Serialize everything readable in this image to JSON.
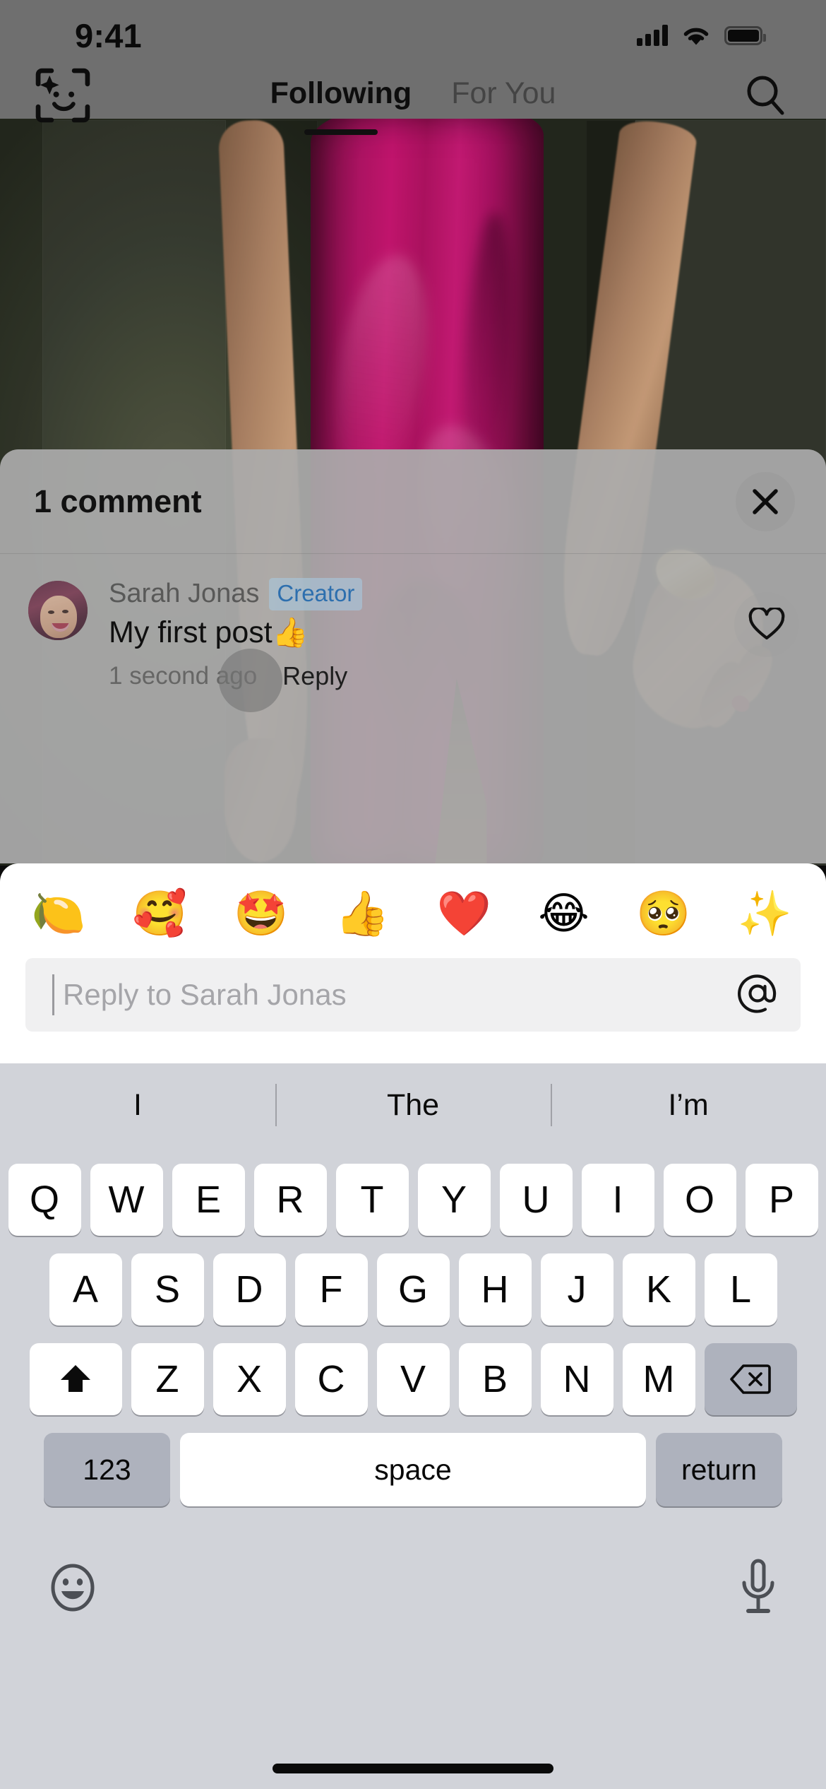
{
  "status_bar": {
    "time": "9:41",
    "signal_icon": "cellular-bars-icon",
    "wifi_icon": "wifi-icon",
    "battery_icon": "battery-full-icon"
  },
  "nav": {
    "live_icon": "live-face-scan-icon",
    "search_icon": "search-icon",
    "tabs": [
      {
        "label": "Following",
        "active": true
      },
      {
        "label": "For You",
        "active": false
      }
    ]
  },
  "comment_sheet": {
    "title": "1 comment",
    "close_icon": "close-icon",
    "comments": [
      {
        "avatar": "user-avatar",
        "name": "Sarah Jonas",
        "badge": "Creator",
        "text": "My first post",
        "text_emoji": "👍",
        "time": "1 second ago",
        "reply_label": "Reply",
        "like_icon": "heart-outline-icon"
      }
    ]
  },
  "reply_panel": {
    "emoji_row": [
      {
        "name": "lemon-emoji",
        "glyph": "🍋"
      },
      {
        "name": "smiling-face-with-hearts-emoji",
        "glyph": "🥰"
      },
      {
        "name": "star-struck-emoji",
        "glyph": "🤩"
      },
      {
        "name": "thumbs-up-emoji",
        "glyph": "👍"
      },
      {
        "name": "red-heart-emoji",
        "glyph": "❤️"
      },
      {
        "name": "face-with-tears-of-joy-emoji",
        "glyph": "😂"
      },
      {
        "name": "pleading-face-emoji",
        "glyph": "🥺"
      },
      {
        "name": "sparkles-emoji",
        "glyph": "✨"
      }
    ],
    "input_placeholder": "Reply to Sarah Jonas",
    "input_value": "",
    "mention_icon": "at-mention-icon"
  },
  "keyboard": {
    "suggestions": [
      "I",
      "The",
      "I’m"
    ],
    "row1": [
      "Q",
      "W",
      "E",
      "R",
      "T",
      "Y",
      "U",
      "I",
      "O",
      "P"
    ],
    "row2": [
      "A",
      "S",
      "D",
      "F",
      "G",
      "H",
      "J",
      "K",
      "L"
    ],
    "row3": [
      "Z",
      "X",
      "C",
      "V",
      "B",
      "N",
      "M"
    ],
    "shift_icon": "shift-up-arrow-icon",
    "backspace_icon": "backspace-delete-icon",
    "numeric_label": "123",
    "space_label": "space",
    "return_label": "return",
    "emoji_keyboard_icon": "smiley-face-icon",
    "dictation_icon": "microphone-icon"
  },
  "colors": {
    "accent_creator_badge": "#2d6fae",
    "keyboard_bg": "#d1d3d9",
    "key_bg": "#ffffff",
    "fn_key_bg": "#aeb2bd",
    "sheet_bg": "#ababab",
    "dress": "#b01464"
  }
}
